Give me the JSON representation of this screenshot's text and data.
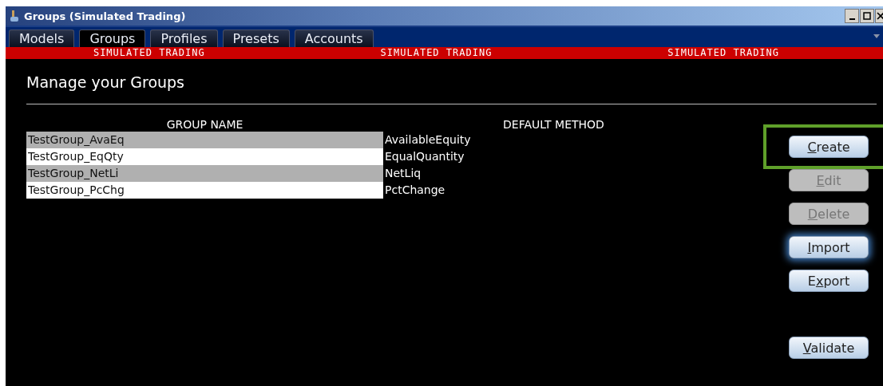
{
  "window": {
    "title": "Groups (Simulated Trading)"
  },
  "tabs": [
    {
      "label": "Models",
      "selected": false
    },
    {
      "label": "Groups",
      "selected": true
    },
    {
      "label": "Profiles",
      "selected": false
    },
    {
      "label": "Presets",
      "selected": false
    },
    {
      "label": "Accounts",
      "selected": false
    }
  ],
  "banner": [
    "SIMULATED TRADING",
    "SIMULATED TRADING",
    "SIMULATED TRADING"
  ],
  "heading": "Manage your Groups",
  "table": {
    "columns": [
      "GROUP NAME",
      "DEFAULT METHOD"
    ],
    "rows": [
      [
        "TestGroup_AvaEq",
        "AvailableEquity"
      ],
      [
        "TestGroup_EqQty",
        "EqualQuantity"
      ],
      [
        "TestGroup_NetLi",
        "NetLiq"
      ],
      [
        "TestGroup_PcChg",
        "PctChange"
      ]
    ]
  },
  "buttons": [
    {
      "key": "C",
      "post": "reate",
      "disabled": false,
      "focused": false,
      "highlighted": true
    },
    {
      "key": "E",
      "post": "dit",
      "disabled": true,
      "focused": false,
      "highlighted": false
    },
    {
      "key": "D",
      "post": "elete",
      "disabled": true,
      "focused": false,
      "highlighted": false
    },
    {
      "key": "I",
      "post": "mport",
      "disabled": false,
      "focused": true,
      "highlighted": false
    },
    {
      "pre": "E",
      "key": "x",
      "post": "port",
      "disabled": false,
      "focused": false,
      "highlighted": false
    },
    {
      "key": "V",
      "post": "alidate",
      "disabled": false,
      "focused": false,
      "highlighted": false
    }
  ]
}
